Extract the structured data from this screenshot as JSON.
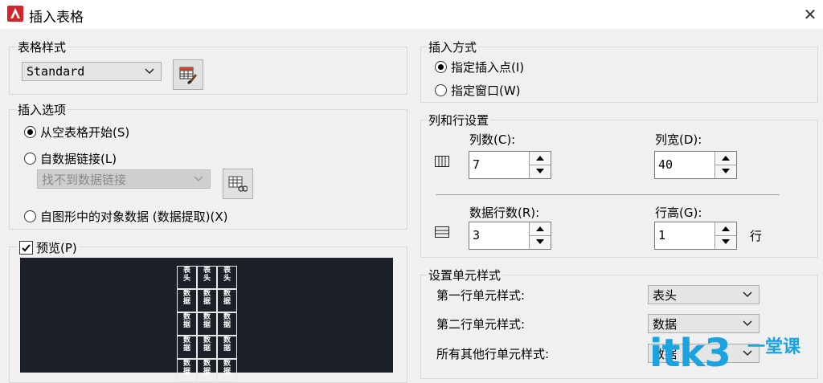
{
  "window": {
    "title": "插入表格",
    "close_glyph": "✕"
  },
  "table_style": {
    "group_label": "表格样式",
    "selected": "Standard"
  },
  "insert_options": {
    "group_label": "插入选项",
    "option_empty": "从空表格开始(S)",
    "option_datalink": "自数据链接(L)",
    "datalink_combo": "找不到数据链接",
    "option_extract": "自图形中的对象数据 (数据提取)(X)",
    "selected": "empty"
  },
  "preview": {
    "checkbox_label": "预览(P)",
    "checked": true,
    "header_text": "表头",
    "data_text": "数据"
  },
  "insert_method": {
    "group_label": "插入方式",
    "option_point": "指定插入点(I)",
    "option_window": "指定窗口(W)",
    "selected": "point"
  },
  "col_row": {
    "group_label": "列和行设置",
    "columns_label": "列数(C):",
    "columns_value": "7",
    "col_width_label": "列宽(D):",
    "col_width_value": "40",
    "data_rows_label": "数据行数(R):",
    "data_rows_value": "3",
    "row_height_label": "行高(G):",
    "row_height_value": "1",
    "row_unit": "行"
  },
  "cell_styles": {
    "group_label": "设置单元样式",
    "first_row_label": "第一行单元样式:",
    "first_row_value": "表头",
    "second_row_label": "第二行单元样式:",
    "second_row_value": "数据",
    "other_rows_label": "所有其他行单元样式:",
    "other_rows_value": "数据"
  },
  "watermark": {
    "text": "itk3",
    "sub": "一堂课"
  },
  "colors": {
    "preview_bg": "#1c2029",
    "accent": "#1aa3e0",
    "app_icon": "#d3262c"
  }
}
